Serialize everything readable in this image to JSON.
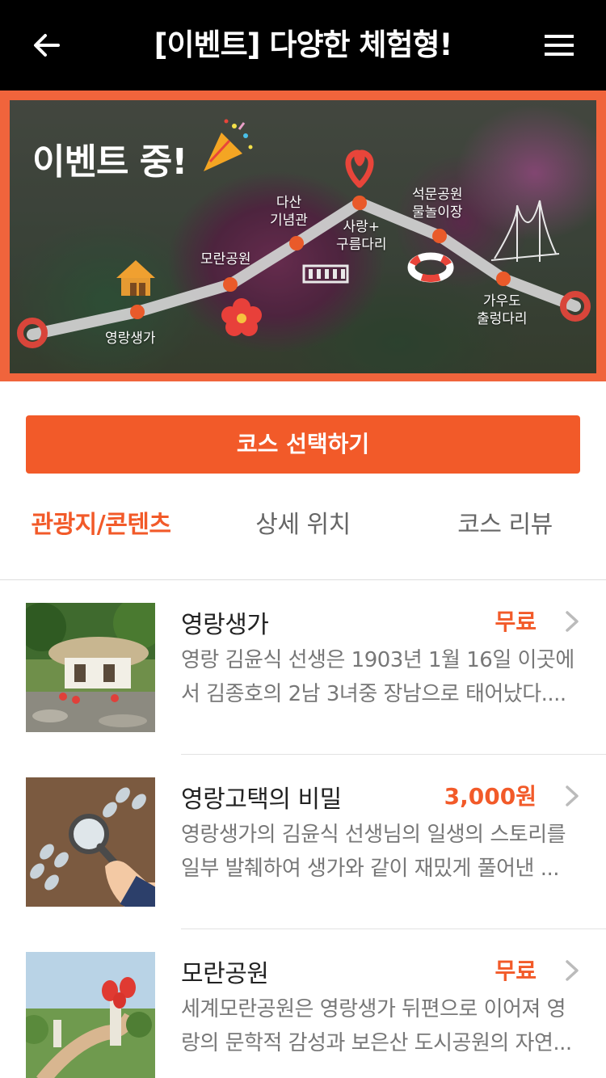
{
  "header": {
    "title": "[이벤트] 다양한 체험형!",
    "back_icon": "arrow-left-icon",
    "menu_icon": "hamburger-menu-icon"
  },
  "banner": {
    "event_text": "이벤트 중!",
    "stops": [
      {
        "label_line1": "영랑생가",
        "label_line2": ""
      },
      {
        "label_line1": "모란공원",
        "label_line2": ""
      },
      {
        "label_line1": "다산",
        "label_line2": "기념관"
      },
      {
        "label_line1": "사랑+",
        "label_line2": "구름다리"
      },
      {
        "label_line1": "석문공원",
        "label_line2": "물놀이장"
      },
      {
        "label_line1": "가우도",
        "label_line2": "출렁다리"
      }
    ]
  },
  "cta": {
    "label": "코스 선택하기"
  },
  "tabs": [
    {
      "label": "관광지/콘텐츠",
      "active": true
    },
    {
      "label": "상세 위치",
      "active": false
    },
    {
      "label": "코스 리뷰",
      "active": false
    }
  ],
  "items": [
    {
      "title": "영랑생가",
      "price": "무료",
      "desc_line1": "영랑 김윤식 선생은 1903년 1월 16일 이곳에",
      "desc_line2": "서 김종호의 2남 3녀중 장남으로 태어났다...."
    },
    {
      "title": "영랑고택의 비밀",
      "price": "3,000원",
      "desc_line1": "영랑생가의 김윤식 선생님의 일생의 스토리를",
      "desc_line2": "일부 발췌하여 생가와 같이 재밌게 풀어낸 ..."
    },
    {
      "title": "모란공원",
      "price": "무료",
      "desc_line1": "세계모란공원은 영랑생가 뒤편으로 이어져 영",
      "desc_line2": "랑의 문학적 감성과 보은산 도시공원의 자연..."
    }
  ],
  "colors": {
    "accent": "#f25a29",
    "header_bg": "#000000",
    "banner_border": "#f0643c"
  }
}
